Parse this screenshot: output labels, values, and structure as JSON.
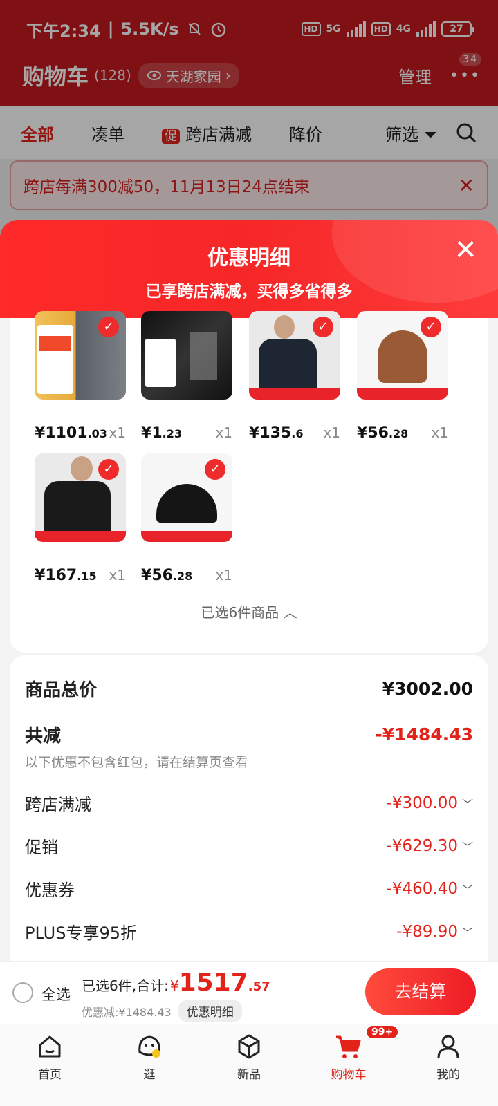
{
  "status": {
    "time": "下午2:34",
    "speed": "5.5K/s",
    "hd1": "HD",
    "net1": "5G",
    "hd2": "HD",
    "net2": "4G",
    "battery": "27"
  },
  "header": {
    "title": "购物车",
    "count": "(128)",
    "location": "天湖家园",
    "manage": "管理",
    "badge": "34"
  },
  "filters": {
    "all": "全部",
    "bundle": "凑单",
    "promo_tag": "促",
    "cross_store": "跨店满减",
    "price_drop": "降价",
    "filter": "筛选"
  },
  "notice": {
    "text": "跨店每满300减50，11月13日24点结束"
  },
  "sheet": {
    "title": "优惠明细",
    "subtitle": "已享跨店满减，买得多省得多"
  },
  "items": [
    {
      "yen": "¥",
      "int": "1101",
      "dec": ".03",
      "qty": "x1",
      "thumb": "fridge"
    },
    {
      "yen": "¥",
      "int": "1",
      "dec": ".23",
      "qty": "x1",
      "thumb": "knife"
    },
    {
      "yen": "¥",
      "int": "135",
      "dec": ".6",
      "qty": "x1",
      "thumb": "sweater"
    },
    {
      "yen": "¥",
      "int": "56",
      "dec": ".28",
      "qty": "x1",
      "thumb": "beanie"
    },
    {
      "yen": "¥",
      "int": "167",
      "dec": ".15",
      "qty": "x1",
      "thumb": "jacket"
    },
    {
      "yen": "¥",
      "int": "56",
      "dec": ".28",
      "qty": "x1",
      "thumb": "cap"
    }
  ],
  "selected_count_text": "已选6件商品",
  "summary": {
    "total_label": "商品总价",
    "total_value": "¥3002.00",
    "reduce_label": "共减",
    "reduce_value": "-¥1484.43",
    "note": "以下优惠不包含红包，请在结算页查看",
    "lines": [
      {
        "label": "跨店满减",
        "value": "-¥300.00"
      },
      {
        "label": "促销",
        "value": "-¥629.30"
      },
      {
        "label": "优惠券",
        "value": "-¥460.40"
      },
      {
        "label": "PLUS专享95折",
        "value": "-¥89.90"
      }
    ]
  },
  "checkout": {
    "select_all": "全选",
    "selected_prefix": "已选6件,合计:",
    "yen": "¥",
    "total_int": "1517",
    "total_dec": ".57",
    "saved": "优惠减:¥1484.43",
    "detail": "优惠明细",
    "button": "去结算"
  },
  "tabbar": [
    {
      "label": "首页",
      "icon": "home-icon"
    },
    {
      "label": "逛",
      "icon": "browse-icon"
    },
    {
      "label": "新品",
      "icon": "new-icon"
    },
    {
      "label": "购物车",
      "icon": "cart-icon",
      "badge": "99+"
    },
    {
      "label": "我的",
      "icon": "user-icon"
    }
  ],
  "colors": {
    "accent": "#e2231a",
    "header_bg": "#c4191f"
  }
}
